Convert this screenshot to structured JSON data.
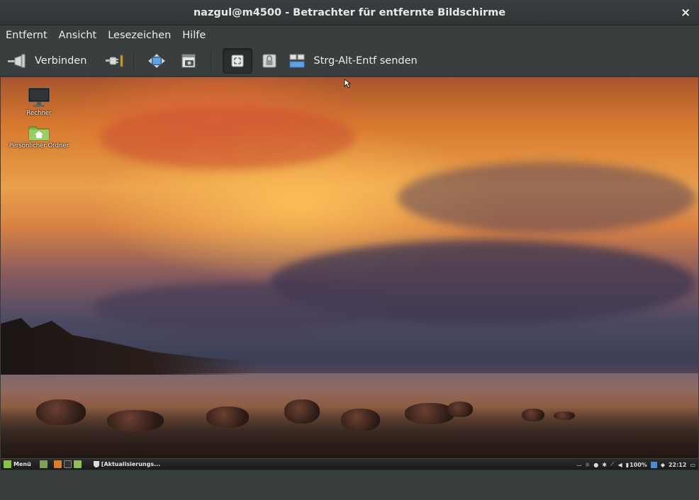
{
  "window": {
    "title": "nazgul@m4500 - Betrachter für entfernte Bildschirme",
    "close_glyph": "×"
  },
  "menubar": {
    "items": [
      {
        "label": "Entfernt"
      },
      {
        "label": "Ansicht"
      },
      {
        "label": "Lesezeichen"
      },
      {
        "label": "Hilfe"
      }
    ]
  },
  "toolbar": {
    "connect_label": "Verbinden",
    "connect_icon": "connect-plug-icon",
    "disconnect_icon": "disconnect-plug-icon",
    "fit_icon": "scale-arrows-icon",
    "screenshot_icon": "screenshot-icon",
    "keyboard_grab_icon": "keyboard-grab-icon",
    "viewonly_icon": "lock-icon",
    "send_cad_icon": "keyboard-send-icon",
    "send_cad_label": "Strg-Alt-Entf senden"
  },
  "remote_desktop": {
    "icons": [
      {
        "label": "Rechner",
        "icon": "computer-monitor-icon"
      },
      {
        "label": "Persönlicher Ordner",
        "icon": "home-folder-icon"
      }
    ],
    "panel": {
      "menu_label": "Menü",
      "task_label": "[Aktualisierungs...",
      "battery": "100%",
      "clock": "22:12"
    },
    "colors": {
      "mint_green": "#87c442",
      "panel_bg": "#222222"
    }
  }
}
